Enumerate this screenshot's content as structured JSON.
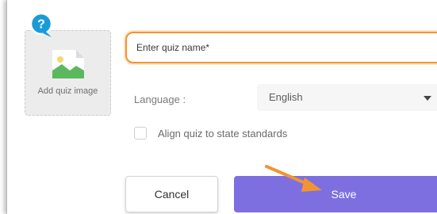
{
  "quiz_image": {
    "label": "Add quiz image",
    "help_icon": "question-mark-icon"
  },
  "quiz_name": {
    "placeholder": "Enter quiz name*",
    "value": ""
  },
  "language": {
    "label": "Language :",
    "selected": "English"
  },
  "standards": {
    "label": "Align quiz to state standards",
    "checked": false
  },
  "buttons": {
    "cancel": "Cancel",
    "save": "Save"
  },
  "colors": {
    "accent": "#7e6fe0",
    "highlight": "#f29431",
    "help": "#1a9bd8"
  }
}
